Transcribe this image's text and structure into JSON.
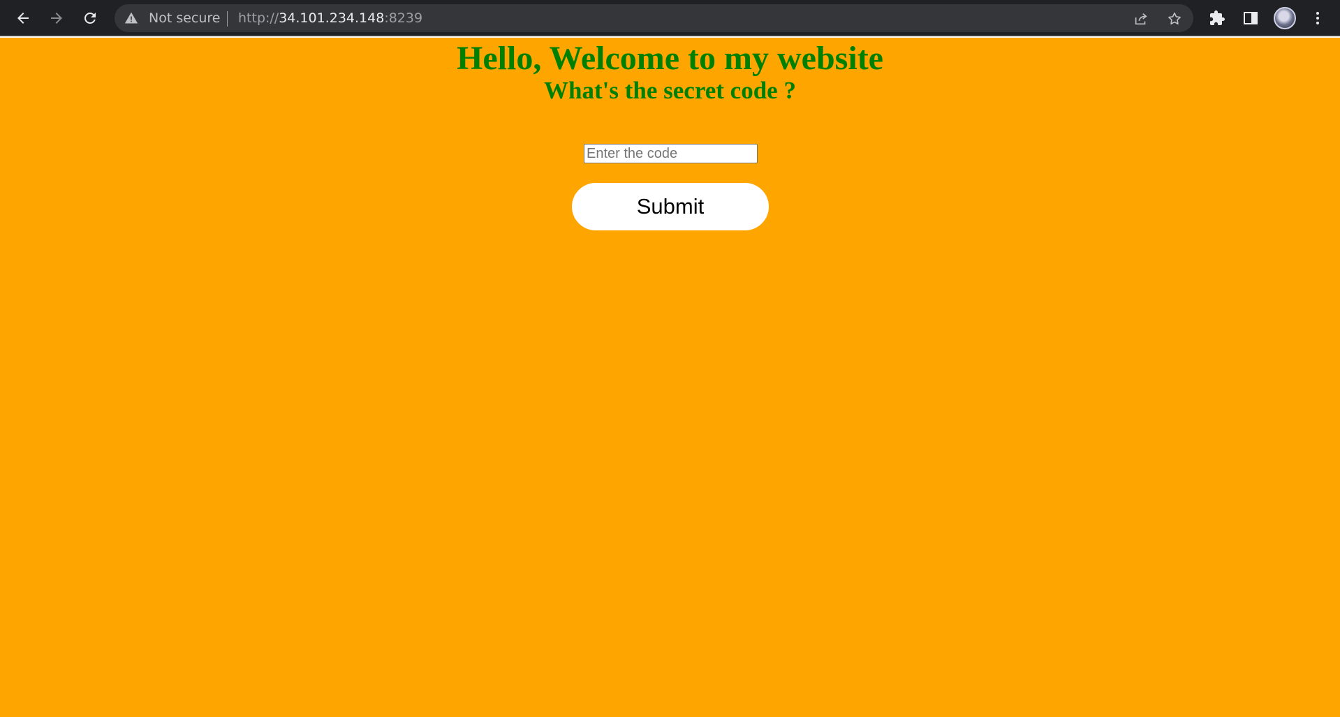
{
  "browser": {
    "security_label": "Not secure",
    "url_scheme": "http://",
    "url_host": "34.101.234.148",
    "url_port": ":8239",
    "icons": {
      "back": "back-arrow-icon",
      "forward": "forward-arrow-icon",
      "reload": "reload-icon",
      "warning": "warning-icon",
      "share": "share-icon",
      "bookmark": "star-icon",
      "extensions": "puzzle-icon",
      "side_panel": "side-panel-icon",
      "menu": "kebab-menu-icon"
    }
  },
  "page": {
    "background_color": "#ffa500",
    "heading_color": "#008000",
    "title": "Hello, Welcome to my website",
    "subtitle": "What's the secret code ?",
    "code_input": {
      "value": "",
      "placeholder": "Enter the code"
    },
    "submit_label": "Submit"
  }
}
